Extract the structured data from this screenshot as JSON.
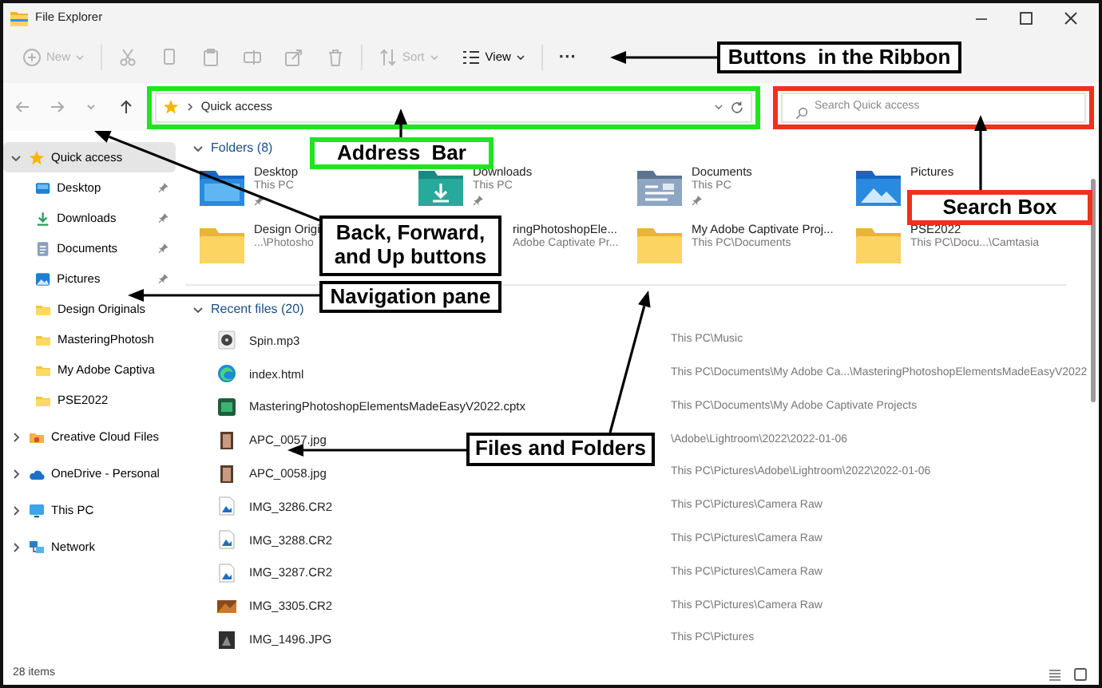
{
  "window": {
    "title": "File Explorer"
  },
  "ribbon": {
    "buttons": [
      {
        "kind": "new",
        "label": "New",
        "disabled": true
      },
      {
        "kind": "cut",
        "disabled": true
      },
      {
        "kind": "copy",
        "disabled": true
      },
      {
        "kind": "paste",
        "disabled": true
      },
      {
        "kind": "rename",
        "disabled": true
      },
      {
        "kind": "share",
        "disabled": true
      },
      {
        "kind": "delete",
        "disabled": true
      },
      {
        "kind": "sort",
        "label": "Sort",
        "disabled": true
      },
      {
        "kind": "view",
        "label": "View",
        "disabled": false
      },
      {
        "kind": "more",
        "label": "···",
        "disabled": false
      }
    ]
  },
  "nav_buttons": [
    {
      "kind": "back",
      "disabled": true
    },
    {
      "kind": "forward",
      "disabled": true
    },
    {
      "kind": "recent",
      "disabled": true
    },
    {
      "kind": "up",
      "disabled": false
    }
  ],
  "address_bar": {
    "path": [
      "Quick access"
    ]
  },
  "search": {
    "placeholder": "Search Quick access"
  },
  "sidebar": {
    "items": [
      {
        "label": "Quick access",
        "kind": "star",
        "selected": true,
        "expanded": true,
        "children": [
          {
            "label": "Desktop",
            "kind": "desktop",
            "selected": false,
            "pinned": true
          },
          {
            "label": "Downloads",
            "kind": "download",
            "selected": false,
            "pinned": true
          },
          {
            "label": "Documents",
            "kind": "documents",
            "selected": false,
            "pinned": true
          },
          {
            "label": "Pictures",
            "kind": "pictures",
            "selected": false,
            "pinned": true
          },
          {
            "label": "Design Originals",
            "kind": "folder",
            "selected": false,
            "pinned": false
          },
          {
            "label": "MasteringPhotosh",
            "kind": "folder",
            "selected": false,
            "pinned": false
          },
          {
            "label": "My Adobe Captiva",
            "kind": "folder",
            "selected": false,
            "pinned": false
          },
          {
            "label": "PSE2022",
            "kind": "folder",
            "selected": false,
            "pinned": false
          }
        ]
      },
      {
        "label": "Creative Cloud Files",
        "kind": "cloud-files",
        "selected": false,
        "expanded": false
      },
      {
        "label": "OneDrive - Personal",
        "kind": "onedrive",
        "selected": false,
        "expanded": false
      },
      {
        "label": "This PC",
        "kind": "pc",
        "selected": false,
        "expanded": false
      },
      {
        "label": "Network",
        "kind": "network",
        "selected": false,
        "expanded": false
      }
    ]
  },
  "folders": {
    "title": "Folders (8)",
    "expanded": true,
    "items": [
      {
        "name": "Desktop",
        "location": "This PC",
        "kind": "desktop",
        "pinned": true
      },
      {
        "name": "Downloads",
        "location": "This PC",
        "kind": "download",
        "pinned": true
      },
      {
        "name": "Documents",
        "location": "This PC",
        "kind": "documents",
        "pinned": true
      },
      {
        "name": "Pictures",
        "kind": "pictures",
        "pinned": false
      },
      {
        "name": "Design Origi",
        "location": "...\\Photosho",
        "kind": "folder",
        "pinned": false
      },
      {
        "name": "ringPhotoshopEle...",
        "location": "Adobe Captivate Pr...",
        "kind": "covered",
        "pinned": false
      },
      {
        "name": "My Adobe Captivate Proj...",
        "location": "This PC\\Documents",
        "kind": "folder",
        "pinned": false
      },
      {
        "name": "PSE2022",
        "location": "This PC\\Docu...\\Camtasia",
        "kind": "folder",
        "pinned": false
      }
    ]
  },
  "recent_files": {
    "title": "Recent files (20)",
    "expanded": true,
    "items": [
      {
        "name": "Spin.mp3",
        "location": "This PC\\Music",
        "kind": "audio"
      },
      {
        "name": "index.html",
        "location": "This PC\\Documents\\My Adobe Ca...\\MasteringPhotoshopElementsMadeEasyV2022",
        "kind": "web"
      },
      {
        "name": "MasteringPhotoshopElementsMadeEasyV2022.cptx",
        "location": "This PC\\Documents\\My Adobe Captivate Projects",
        "kind": "project"
      },
      {
        "name": "APC_0057.jpg",
        "location": "\\Adobe\\Lightroom\\2022\\2022-01-06",
        "kind": "photo"
      },
      {
        "name": "APC_0058.jpg",
        "location": "This PC\\Pictures\\Adobe\\Lightroom\\2022\\2022-01-06",
        "kind": "photo"
      },
      {
        "name": "IMG_3286.CR2",
        "location": "This PC\\Pictures\\Camera Raw",
        "kind": "raw"
      },
      {
        "name": "IMG_3288.CR2",
        "location": "This PC\\Pictures\\Camera Raw",
        "kind": "raw"
      },
      {
        "name": "IMG_3287.CR2",
        "location": "This PC\\Pictures\\Camera Raw",
        "kind": "raw"
      },
      {
        "name": "IMG_3305.CR2",
        "location": "This PC\\Pictures\\Camera Raw",
        "kind": "photo-warm"
      },
      {
        "name": "IMG_1496.JPG",
        "location": "This PC\\Pictures",
        "kind": "photo-dark"
      }
    ]
  },
  "status_bar": {
    "text": "28 items"
  },
  "annotations": [
    {
      "text": "Buttons  in the Ribbon",
      "color": "#000000"
    },
    {
      "text": "Address  Bar",
      "color": "#1ee61e"
    },
    {
      "text": "Search Box",
      "color": "#f0301c"
    },
    {
      "text": "Back, Forward, and Up buttons",
      "color": "#000000"
    },
    {
      "text": "Navigation pane",
      "color": "#000000"
    },
    {
      "text": "Files and Folders",
      "color": "#000000"
    }
  ]
}
